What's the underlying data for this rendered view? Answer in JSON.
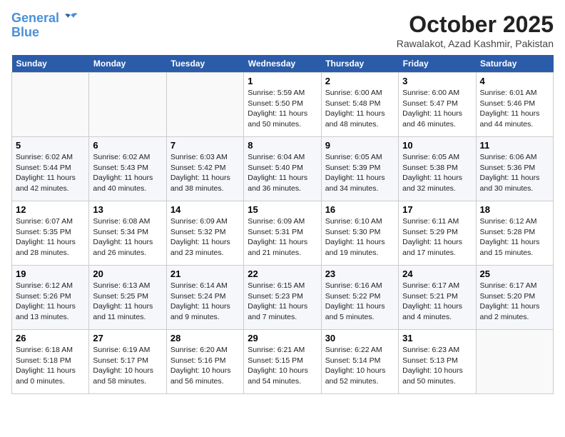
{
  "header": {
    "logo_line1": "General",
    "logo_line2": "Blue",
    "title": "October 2025",
    "location": "Rawalakot, Azad Kashmir, Pakistan"
  },
  "weekdays": [
    "Sunday",
    "Monday",
    "Tuesday",
    "Wednesday",
    "Thursday",
    "Friday",
    "Saturday"
  ],
  "weeks": [
    [
      {
        "day": "",
        "info": ""
      },
      {
        "day": "",
        "info": ""
      },
      {
        "day": "",
        "info": ""
      },
      {
        "day": "1",
        "info": "Sunrise: 5:59 AM\nSunset: 5:50 PM\nDaylight: 11 hours and 50 minutes."
      },
      {
        "day": "2",
        "info": "Sunrise: 6:00 AM\nSunset: 5:48 PM\nDaylight: 11 hours and 48 minutes."
      },
      {
        "day": "3",
        "info": "Sunrise: 6:00 AM\nSunset: 5:47 PM\nDaylight: 11 hours and 46 minutes."
      },
      {
        "day": "4",
        "info": "Sunrise: 6:01 AM\nSunset: 5:46 PM\nDaylight: 11 hours and 44 minutes."
      }
    ],
    [
      {
        "day": "5",
        "info": "Sunrise: 6:02 AM\nSunset: 5:44 PM\nDaylight: 11 hours and 42 minutes."
      },
      {
        "day": "6",
        "info": "Sunrise: 6:02 AM\nSunset: 5:43 PM\nDaylight: 11 hours and 40 minutes."
      },
      {
        "day": "7",
        "info": "Sunrise: 6:03 AM\nSunset: 5:42 PM\nDaylight: 11 hours and 38 minutes."
      },
      {
        "day": "8",
        "info": "Sunrise: 6:04 AM\nSunset: 5:40 PM\nDaylight: 11 hours and 36 minutes."
      },
      {
        "day": "9",
        "info": "Sunrise: 6:05 AM\nSunset: 5:39 PM\nDaylight: 11 hours and 34 minutes."
      },
      {
        "day": "10",
        "info": "Sunrise: 6:05 AM\nSunset: 5:38 PM\nDaylight: 11 hours and 32 minutes."
      },
      {
        "day": "11",
        "info": "Sunrise: 6:06 AM\nSunset: 5:36 PM\nDaylight: 11 hours and 30 minutes."
      }
    ],
    [
      {
        "day": "12",
        "info": "Sunrise: 6:07 AM\nSunset: 5:35 PM\nDaylight: 11 hours and 28 minutes."
      },
      {
        "day": "13",
        "info": "Sunrise: 6:08 AM\nSunset: 5:34 PM\nDaylight: 11 hours and 26 minutes."
      },
      {
        "day": "14",
        "info": "Sunrise: 6:09 AM\nSunset: 5:32 PM\nDaylight: 11 hours and 23 minutes."
      },
      {
        "day": "15",
        "info": "Sunrise: 6:09 AM\nSunset: 5:31 PM\nDaylight: 11 hours and 21 minutes."
      },
      {
        "day": "16",
        "info": "Sunrise: 6:10 AM\nSunset: 5:30 PM\nDaylight: 11 hours and 19 minutes."
      },
      {
        "day": "17",
        "info": "Sunrise: 6:11 AM\nSunset: 5:29 PM\nDaylight: 11 hours and 17 minutes."
      },
      {
        "day": "18",
        "info": "Sunrise: 6:12 AM\nSunset: 5:28 PM\nDaylight: 11 hours and 15 minutes."
      }
    ],
    [
      {
        "day": "19",
        "info": "Sunrise: 6:12 AM\nSunset: 5:26 PM\nDaylight: 11 hours and 13 minutes."
      },
      {
        "day": "20",
        "info": "Sunrise: 6:13 AM\nSunset: 5:25 PM\nDaylight: 11 hours and 11 minutes."
      },
      {
        "day": "21",
        "info": "Sunrise: 6:14 AM\nSunset: 5:24 PM\nDaylight: 11 hours and 9 minutes."
      },
      {
        "day": "22",
        "info": "Sunrise: 6:15 AM\nSunset: 5:23 PM\nDaylight: 11 hours and 7 minutes."
      },
      {
        "day": "23",
        "info": "Sunrise: 6:16 AM\nSunset: 5:22 PM\nDaylight: 11 hours and 5 minutes."
      },
      {
        "day": "24",
        "info": "Sunrise: 6:17 AM\nSunset: 5:21 PM\nDaylight: 11 hours and 4 minutes."
      },
      {
        "day": "25",
        "info": "Sunrise: 6:17 AM\nSunset: 5:20 PM\nDaylight: 11 hours and 2 minutes."
      }
    ],
    [
      {
        "day": "26",
        "info": "Sunrise: 6:18 AM\nSunset: 5:18 PM\nDaylight: 11 hours and 0 minutes."
      },
      {
        "day": "27",
        "info": "Sunrise: 6:19 AM\nSunset: 5:17 PM\nDaylight: 10 hours and 58 minutes."
      },
      {
        "day": "28",
        "info": "Sunrise: 6:20 AM\nSunset: 5:16 PM\nDaylight: 10 hours and 56 minutes."
      },
      {
        "day": "29",
        "info": "Sunrise: 6:21 AM\nSunset: 5:15 PM\nDaylight: 10 hours and 54 minutes."
      },
      {
        "day": "30",
        "info": "Sunrise: 6:22 AM\nSunset: 5:14 PM\nDaylight: 10 hours and 52 minutes."
      },
      {
        "day": "31",
        "info": "Sunrise: 6:23 AM\nSunset: 5:13 PM\nDaylight: 10 hours and 50 minutes."
      },
      {
        "day": "",
        "info": ""
      }
    ]
  ]
}
